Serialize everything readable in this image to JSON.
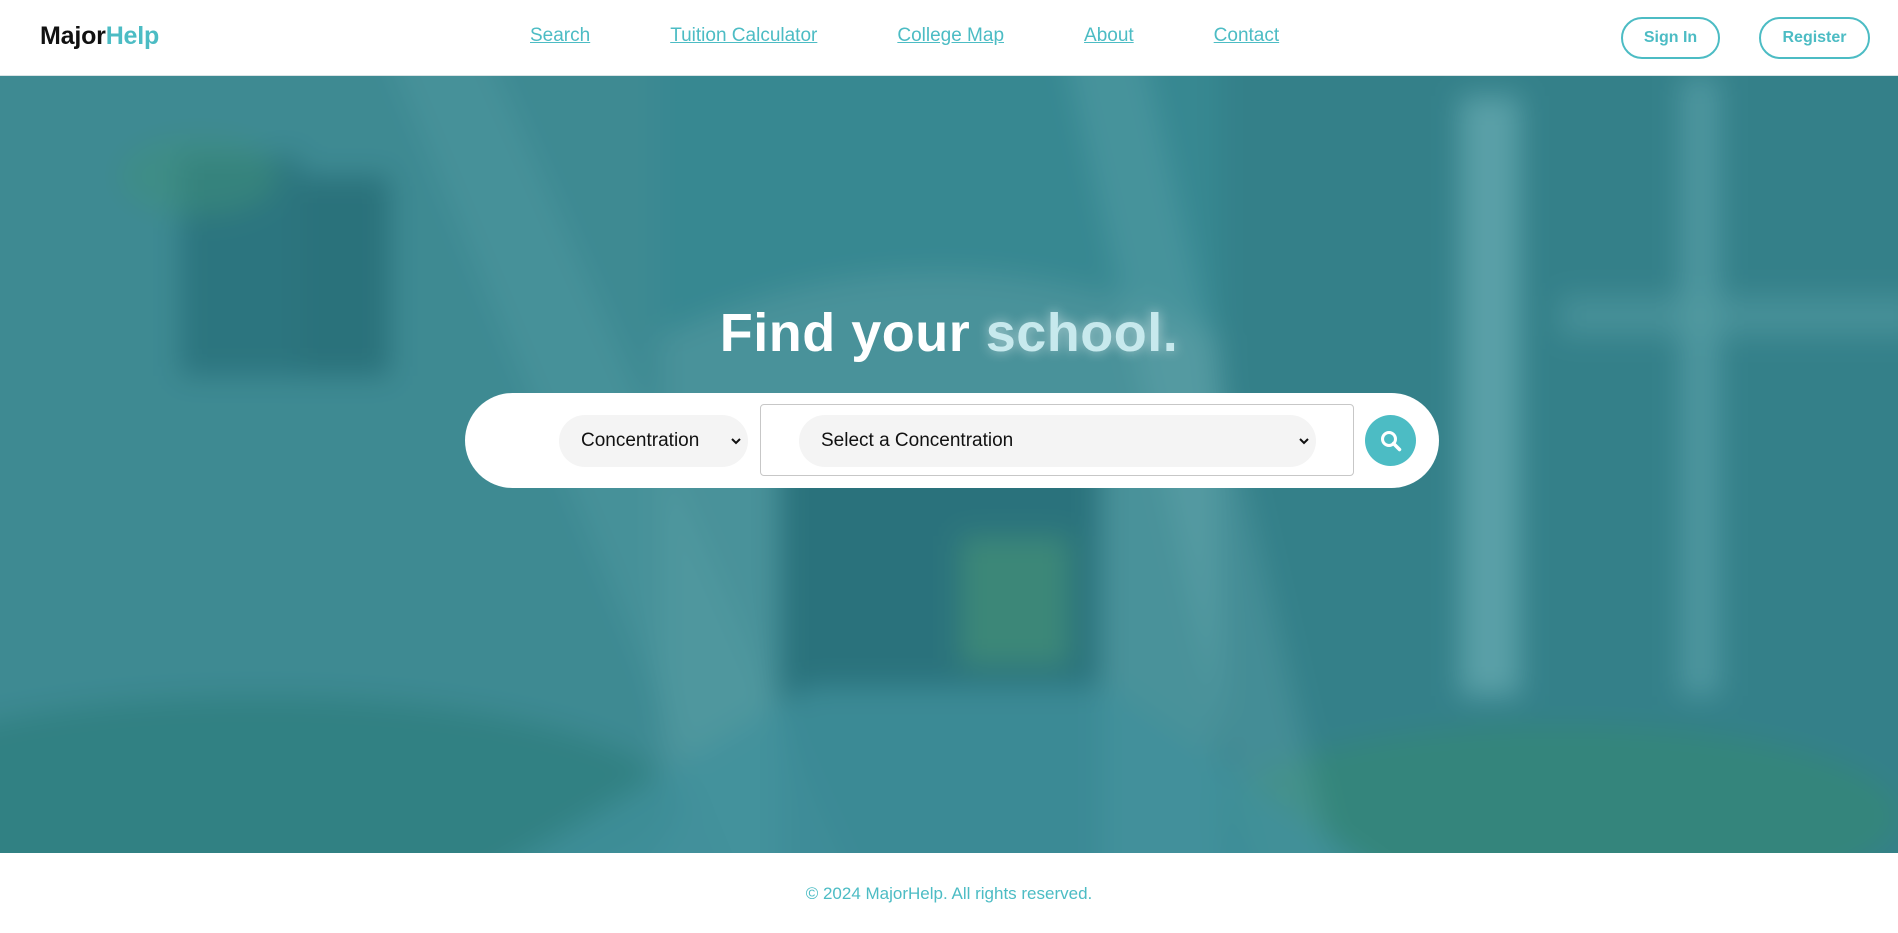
{
  "brand": {
    "name_part1": "Major",
    "name_part2": "Help",
    "accent_color": "#4cbcc4"
  },
  "nav": {
    "items": [
      {
        "label": "Search"
      },
      {
        "label": "Tuition Calculator"
      },
      {
        "label": "College Map"
      },
      {
        "label": "About"
      },
      {
        "label": "Contact"
      }
    ]
  },
  "auth": {
    "signin_label": "Sign In",
    "register_label": "Register"
  },
  "hero": {
    "title_part1": "Find your",
    "title_part2": "school.",
    "filter_type": {
      "selected": "Concentration"
    },
    "concentration": {
      "selected": "Select a Concentration"
    },
    "search_icon": "search-icon",
    "background": "blurred campus archway photo with teal overlay"
  },
  "footer": {
    "copyright": "© 2024 MajorHelp. All rights reserved."
  }
}
